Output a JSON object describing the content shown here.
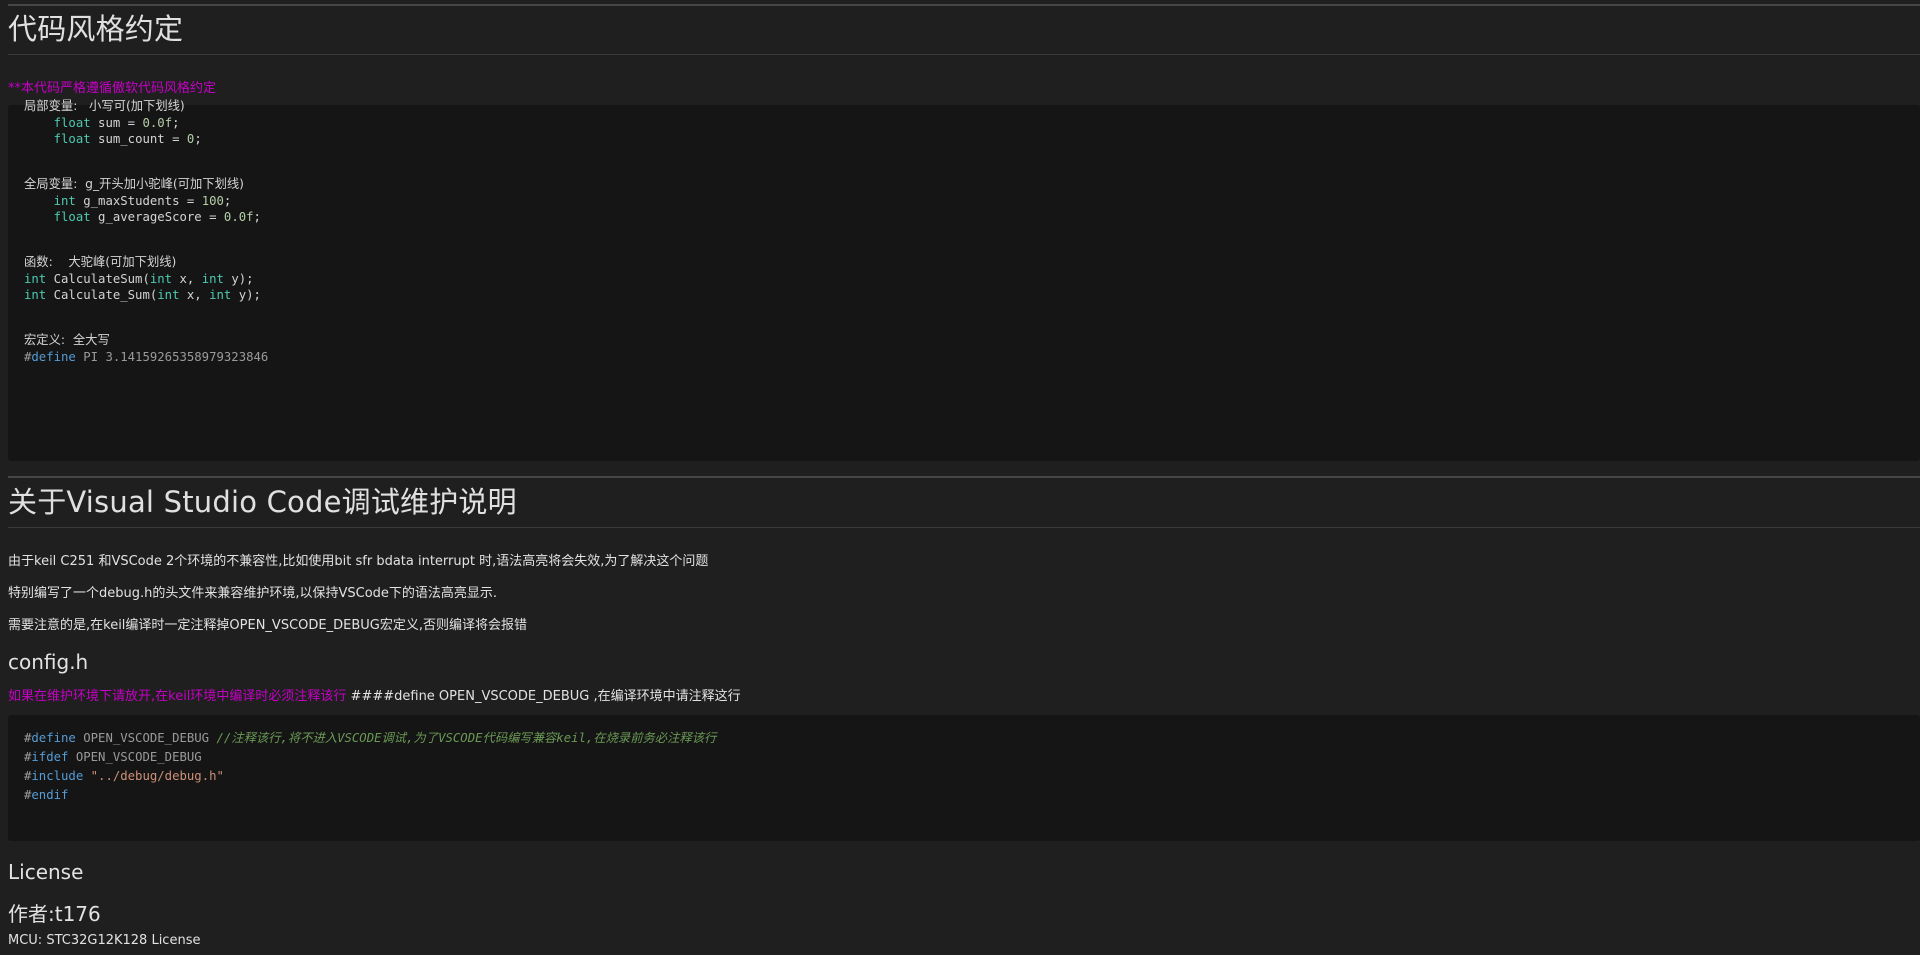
{
  "section1": {
    "title": "代码风格约定",
    "note": "**本代码严格遵循傲软代码风格约定"
  },
  "code_style": {
    "local": {
      "label": "局部变量:   小写可(加下划线)",
      "line1": {
        "type": "float",
        "rest_a": " sum = ",
        "num": "0.0f",
        "rest_b": ";"
      },
      "line2": {
        "type": "float",
        "rest_a": " sum_count = ",
        "num": "0",
        "rest_b": ";"
      }
    },
    "global": {
      "label": "全局变量:  g_开头加小驼峰(可加下划线)",
      "line1": {
        "type": "int",
        "rest_a": " g_maxStudents = ",
        "num": "100",
        "rest_b": ";"
      },
      "line2": {
        "type": "float",
        "rest_a": " g_averageScore = ",
        "num": "0.0f",
        "rest_b": ";"
      }
    },
    "func": {
      "label": "函数:    大驼峰(可加下划线)",
      "line1": {
        "t1": "int",
        "a": " CalculateSum(",
        "t2": "int",
        "b": " x, ",
        "t3": "int",
        "c": " y);"
      },
      "line2": {
        "t1": "int",
        "a": " Calculate_Sum(",
        "t2": "int",
        "b": " x, ",
        "t3": "int",
        "c": " y);"
      }
    },
    "macro": {
      "label": "宏定义:  全大写",
      "hash": "#",
      "kw": "define",
      "rest": " PI 3.14159265358979323846"
    }
  },
  "section2": {
    "title": "关于Visual Studio Code调试维护说明",
    "p1": "由于keil C251 和VSCode 2个环境的不兼容性,比如使用bit sfr bdata interrupt 时,语法高亮将会失效,为了解决这个问题",
    "p2": "特别编写了一个debug.h的头文件来兼容维护环境,以保持VSCode下的语法高亮显示.",
    "p3": "需要注意的是,在keil编译时一定注释掉OPEN_VSCODE_DEBUG宏定义,否则编译将会报错"
  },
  "config": {
    "title": "config.h",
    "note_pink": "如果在维护环境下请放开,在keil环境中编译时必须注释该行",
    "note_white": " ####define OPEN_VSCODE_DEBUG ,在编译环境中请注释这行",
    "code": {
      "l1_hash": "#",
      "l1_kw": "define",
      "l1_rest": " OPEN_VSCODE_DEBUG ",
      "l1_comment": "//注释该行,将不进入VSCODE调试,为了VSCODE代码编写兼容keil,在烧录前务必注释该行",
      "l2_hash": "#",
      "l2_kw": "ifdef",
      "l2_rest": " OPEN_VSCODE_DEBUG",
      "l3_hash": "#",
      "l3_kw": "include",
      "l3_str": " \"../debug/debug.h\"",
      "l4_hash": "#",
      "l4_kw": "endif"
    }
  },
  "license": {
    "title": "License",
    "author": "作者:t176",
    "mcu": "MCU: STC32G12K128 License"
  },
  "colors": {
    "background": "#1f1f1f",
    "code_background": "#151515",
    "pink": "#c600c6",
    "keyword": "#569cd6",
    "type": "#4ec9b0",
    "number": "#b5cea8",
    "string": "#ce9178",
    "comment": "#6a9955"
  }
}
